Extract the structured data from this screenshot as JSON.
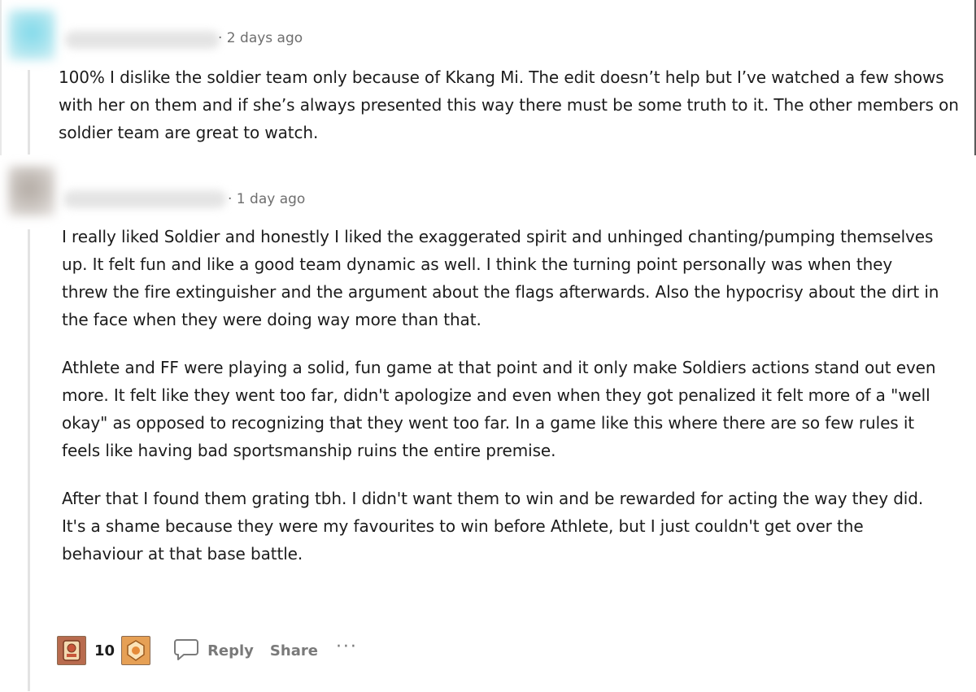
{
  "comments": [
    {
      "age": "· 2 days ago",
      "paragraphs": [
        "100% I dislike the soldier team only because of Kkang Mi. The edit doesn’t help but I’ve watched a few shows with her on them and if she’s always presented this way there must be some truth to it. The other members on soldier team are great to watch."
      ]
    },
    {
      "age": "· 1 day ago",
      "paragraphs": [
        "I really liked Soldier and honestly I liked the exaggerated spirit and unhinged chanting/pumping themselves up. It felt fun and like a good team dynamic as well. I think the turning point personally was when they threw the fire extinguisher and the argument about the flags afterwards. Also the hypocrisy about the dirt in the face when they were doing way more than that.",
        "Athlete and FF were playing a solid, fun game at that point and it only make Soldiers actions stand out even more. It felt like they went too far, didn't apologize and even when they got penalized it felt more of a \"well okay\" as opposed to recognizing that they went too far. In a game like this where there are so few rules it feels like having bad sportsmanship ruins the entire premise.",
        "After that I found them grating tbh. I didn't want them to win and be rewarded for acting the way they did. It's a shame because they were my favourites to win before Athlete, but I just couldn't get over the behaviour at that base battle."
      ],
      "awards": {
        "count": "10",
        "icons": [
          "award-badge-icon",
          "award-emblem-icon"
        ]
      },
      "actions": {
        "reply_label": "Reply",
        "share_label": "Share",
        "more_label": "···"
      }
    }
  ],
  "colors": {
    "meta_text": "#6e6e6e",
    "action_text": "#7a7a7a",
    "thread_line": "#e3e3e3",
    "award_1": "#b86b4e",
    "award_2": "#e6a055"
  }
}
